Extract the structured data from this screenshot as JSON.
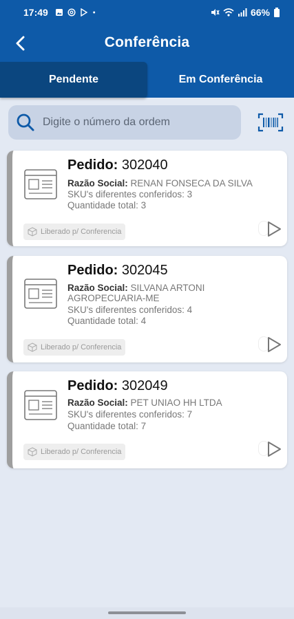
{
  "status_bar": {
    "time": "17:49",
    "battery": "66%"
  },
  "app_bar": {
    "title": "Conferência"
  },
  "tabs": [
    {
      "label": "Pendente",
      "active": true
    },
    {
      "label": "Em Conferência",
      "active": false
    }
  ],
  "search": {
    "placeholder": "Digite o número da ordem",
    "value": ""
  },
  "orders": [
    {
      "title_label": "Pedido:",
      "number": "302040",
      "razao_label": "Razão Social:",
      "razao_value": "RENAN FONSECA DA SILVA",
      "sku_text": "SKU's diferentes conferidos: 3",
      "qty_text": "Quantidade total: 3",
      "status": "Liberado p/ Conferencia"
    },
    {
      "title_label": "Pedido:",
      "number": "302045",
      "razao_label": "Razão Social:",
      "razao_value": "SILVANA ARTONI AGROPECUARIA-ME",
      "sku_text": "SKU's diferentes conferidos: 4",
      "qty_text": "Quantidade total: 4",
      "status": "Liberado p/ Conferencia"
    },
    {
      "title_label": "Pedido:",
      "number": "302049",
      "razao_label": "Razão Social:",
      "razao_value": "PET UNIAO HH LTDA",
      "sku_text": "SKU's diferentes conferidos: 7",
      "qty_text": "Quantidade total: 7",
      "status": "Liberado p/ Conferencia"
    }
  ],
  "colors": {
    "primary": "#0e5aa8",
    "tab_active": "#0b467f",
    "background": "#e3e9f3",
    "search_bg": "#c8d3e5",
    "card_border": "#9e9e9e"
  }
}
